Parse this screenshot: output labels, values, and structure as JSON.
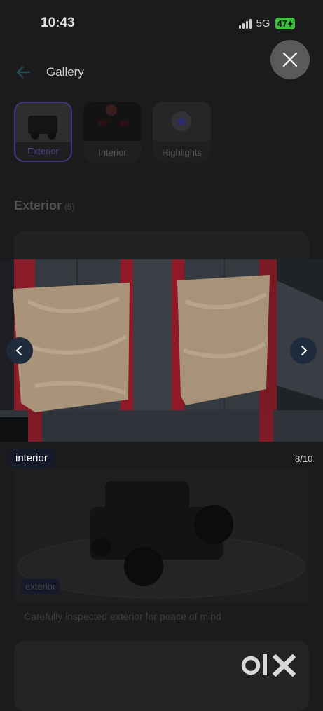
{
  "status_bar": {
    "time": "10:43",
    "network": "5G",
    "battery": "47"
  },
  "header": {
    "title": "Gallery"
  },
  "thumbnails": [
    {
      "label": "Exterior",
      "active": true
    },
    {
      "label": "Interior",
      "active": false
    },
    {
      "label": "Highlights",
      "active": false
    }
  ],
  "section": {
    "title": "Exterior",
    "count": "(5)"
  },
  "viewer": {
    "tag": "interior",
    "counter": "8/10"
  },
  "next_card": {
    "tag": "exterior",
    "caption": "Carefully inspected exterior for peace of mind"
  },
  "colors": {
    "background": "#1b1b1d",
    "battery": "#3fbf3f",
    "accent": "#3a3a78"
  },
  "icons": [
    "back-arrow-icon",
    "close-icon",
    "chevron-left-icon",
    "chevron-right-icon",
    "star-icon"
  ]
}
